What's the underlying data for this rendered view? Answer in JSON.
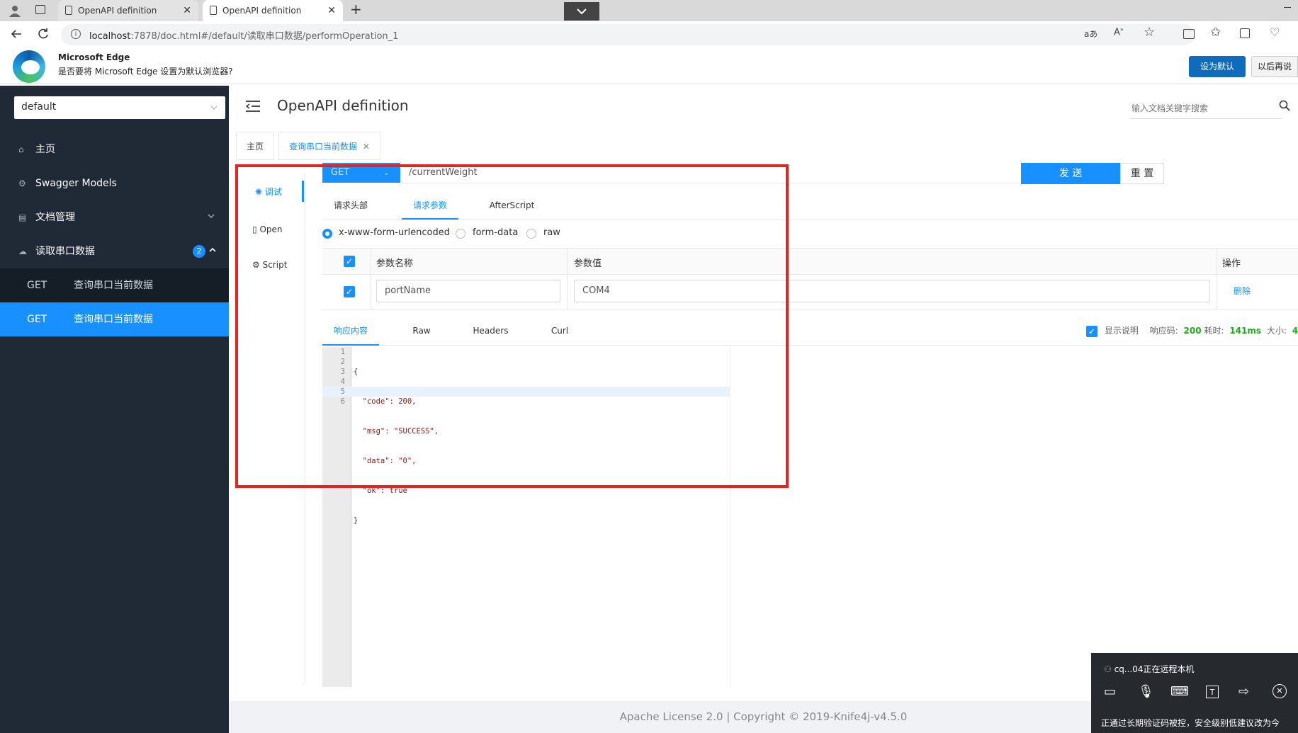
{
  "browser": {
    "tabs": [
      {
        "title": "OpenAPI definition"
      },
      {
        "title": "OpenAPI definition"
      }
    ],
    "url_host": "localhost",
    "url_rest": ":7878/doc.html#/default/读取串口数据/performOperation_1",
    "reader_label": "aあ",
    "infobar": {
      "title": "Microsoft Edge",
      "message": "是否要将 Microsoft Edge 设置为默认浏览器?",
      "set_default": "设为默认",
      "later": "以后再说"
    }
  },
  "sidebar": {
    "group_select": "default",
    "items": [
      {
        "icon": "home-icon",
        "label": "主页"
      },
      {
        "icon": "models-icon",
        "label": "Swagger Models"
      },
      {
        "icon": "docs-icon",
        "label": "文档管理"
      },
      {
        "icon": "cloud-icon",
        "label": "读取串口数据",
        "badge": "2"
      }
    ],
    "sub_items": [
      {
        "method": "GET",
        "label": "查询串口当前数据"
      },
      {
        "method": "GET",
        "label": "查询串口当前数据"
      }
    ]
  },
  "header": {
    "title": "OpenAPI definition",
    "search_placeholder": "输入文档关键字搜索"
  },
  "page_tabs": [
    {
      "label": "主页"
    },
    {
      "label": "查询串口当前数据"
    }
  ],
  "left_nav": [
    {
      "label": "调试"
    },
    {
      "label": "Open"
    },
    {
      "label": "Script"
    }
  ],
  "request": {
    "method": "GET",
    "path": "/currentWeight",
    "send_label": "发 送",
    "reset_label": "重 置",
    "tabs": [
      "请求头部",
      "请求参数",
      "AfterScript"
    ],
    "content_types": [
      "x-www-form-urlencoded",
      "form-data",
      "raw"
    ],
    "table_headers": {
      "name": "参数名称",
      "value": "参数值",
      "action": "操作"
    },
    "params": [
      {
        "name": "portName",
        "value": "COM4",
        "action": "删除"
      }
    ]
  },
  "response": {
    "tabs": [
      "响应内容",
      "Raw",
      "Headers",
      "Curl"
    ],
    "show_desc": "显示说明",
    "status_label": "响应码:",
    "status_code": "200",
    "time_label": "耗时:",
    "time_value": "141ms",
    "size_label": "大小:",
    "size_value": "4",
    "code_lines": [
      "{",
      "  \"code\": 200,",
      "  \"msg\": \"SUCCESS\",",
      "  \"data\": \"0\",",
      "  \"ok\": true",
      "}"
    ]
  },
  "remote": {
    "status": "cq...04正在远程本机",
    "bottom_text": "正通过长期验证码被控，安全级别低建议改为今"
  },
  "footer": {
    "text": "Apache License 2.0 | Copyright © 2019-Knife4j-v4.5.0"
  },
  "colors": {
    "accent": "#1890ff",
    "sidebar_bg": "#1f2a36",
    "active_item": "#1890ff",
    "highlight_box": "#e8231f",
    "success": "#1aad19"
  }
}
